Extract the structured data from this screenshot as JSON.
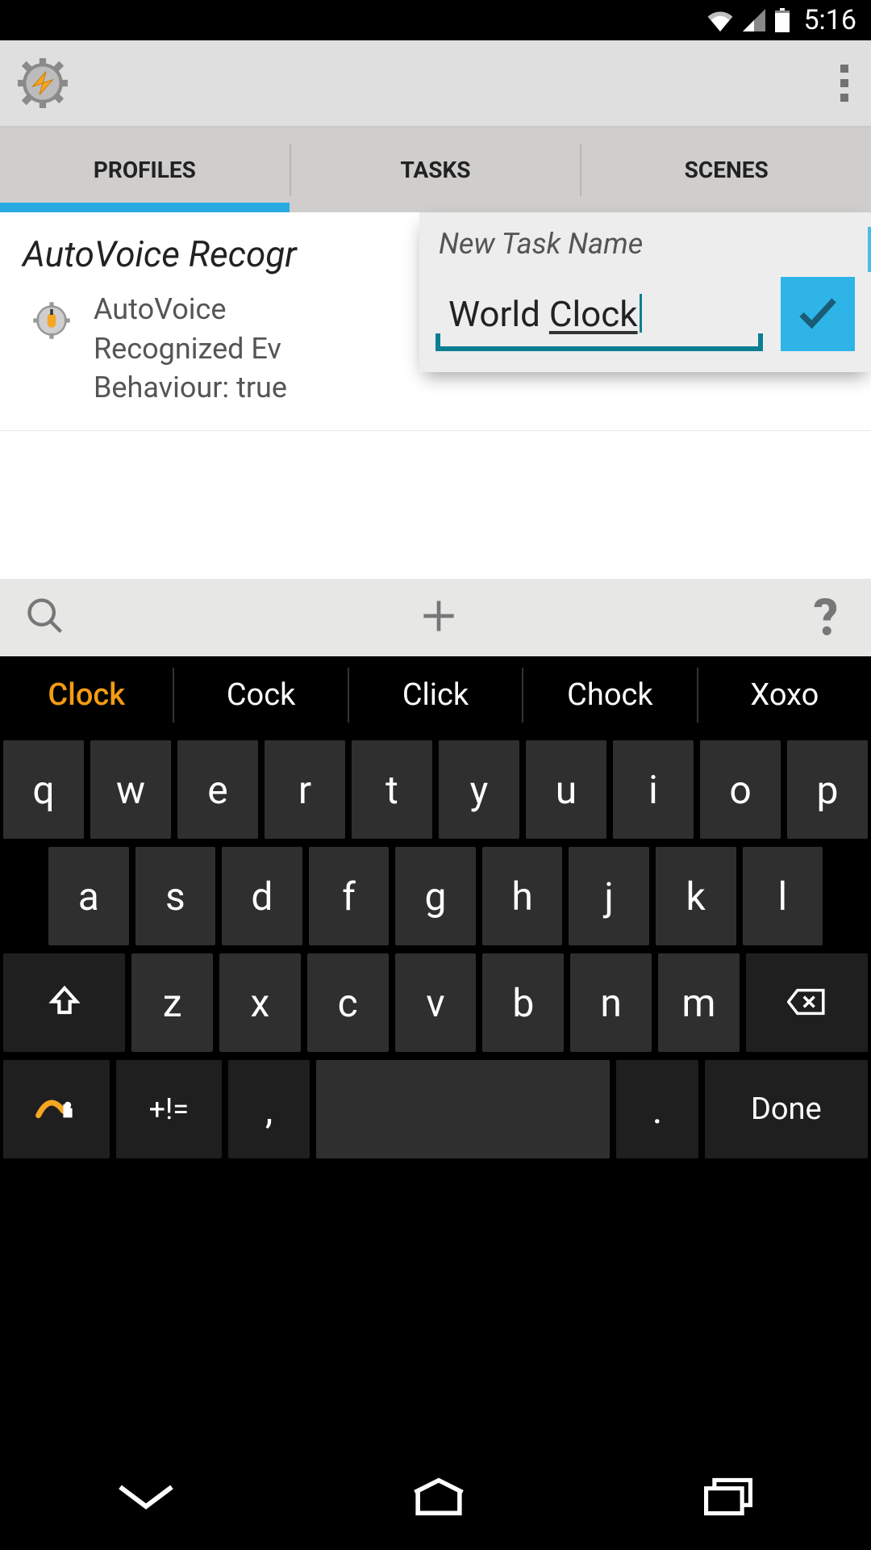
{
  "status": {
    "time": "5:16"
  },
  "tabs": {
    "profiles": "PROFILES",
    "tasks": "TASKS",
    "scenes": "SCENES",
    "active": "profiles"
  },
  "profile": {
    "title": "AutoVoice Recogr",
    "item_line1": "AutoVoice",
    "item_line2": "Recognized Ev",
    "item_line3": "Behaviour: true"
  },
  "dialog": {
    "title": "New Task Name",
    "input_word1": "World ",
    "input_word2": "Clock"
  },
  "suggestions": [
    "Clock",
    "Cock",
    "Click",
    "Chock",
    "Xoxo"
  ],
  "keyboard": {
    "row1": [
      "q",
      "w",
      "e",
      "r",
      "t",
      "y",
      "u",
      "i",
      "o",
      "p"
    ],
    "row2": [
      "a",
      "s",
      "d",
      "f",
      "g",
      "h",
      "j",
      "k",
      "l"
    ],
    "row3": [
      "z",
      "x",
      "c",
      "v",
      "b",
      "n",
      "m"
    ],
    "bottom": {
      "symbols": "+!=",
      "comma": ",",
      "period": ".",
      "done": "Done"
    }
  }
}
